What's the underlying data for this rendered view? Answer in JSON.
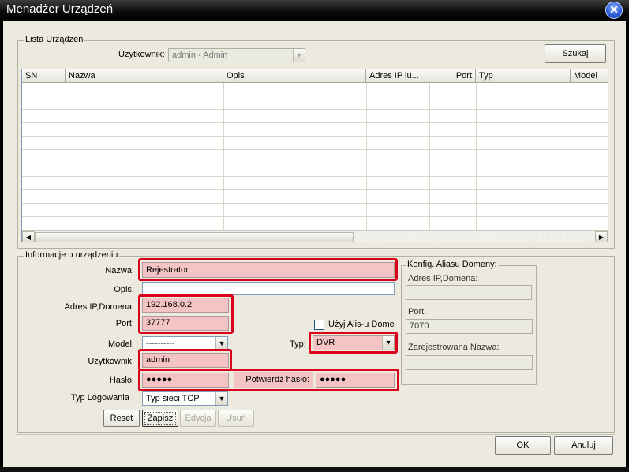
{
  "window": {
    "title": "Menadżer Urządzeń"
  },
  "device_list": {
    "group_title": "Lista Urządzeń",
    "user_label": "Użytkownik:",
    "user_value": "admin - Admin",
    "search_label": "Szukaj",
    "columns": [
      "SN",
      "Nazwa",
      "Opis",
      "Adres IP lu...",
      "Port",
      "Typ",
      "Model"
    ]
  },
  "device_info": {
    "group_title": "Informacje o urządzeniu",
    "name_label": "Nazwa:",
    "name_value": "Rejestrator",
    "desc_label": "Opis:",
    "desc_value": "",
    "ip_label": "Adres IP,Domena:",
    "ip_value": "192.168.0.2",
    "port_label": "Port:",
    "port_value": "37777",
    "alias_checkbox_label": "Użyj Alis-u Dome",
    "model_label": "Model:",
    "model_value": "----------",
    "type_label": "Typ:",
    "type_value": "DVR",
    "user_label": "Użytkownik:",
    "user_value": "admin",
    "password_label": "Hasło:",
    "password_value": "●●●●●",
    "confirm_password_label": "Potwierdź hasło:",
    "confirm_password_value": "●●●●●",
    "login_type_label": "Typ Logowania :",
    "login_type_value": "Typ sieci TCP"
  },
  "alias_config": {
    "group_title": "Konfig. Aliasu Domeny:",
    "address_label": "Adres IP,Domena:",
    "address_value": "",
    "port_label": "Port:",
    "port_value": "7070",
    "registered_name_label": "Zarejestrowana Nazwa:",
    "registered_name_value": ""
  },
  "actions": {
    "reset": "Reset",
    "save": "Zapisz",
    "edit": "Edycja",
    "delete": "Usuń"
  },
  "dialog": {
    "ok": "OK",
    "cancel": "Anuluj"
  },
  "icons": {
    "close": "close-icon",
    "dropdown": "chevron-down-icon",
    "scroll_left": "arrow-left-icon",
    "scroll_right": "arrow-right-icon"
  },
  "colors": {
    "highlight": "#d8001b",
    "highlight_fill": "#f4c4c4",
    "window_bg": "#eceadf"
  }
}
